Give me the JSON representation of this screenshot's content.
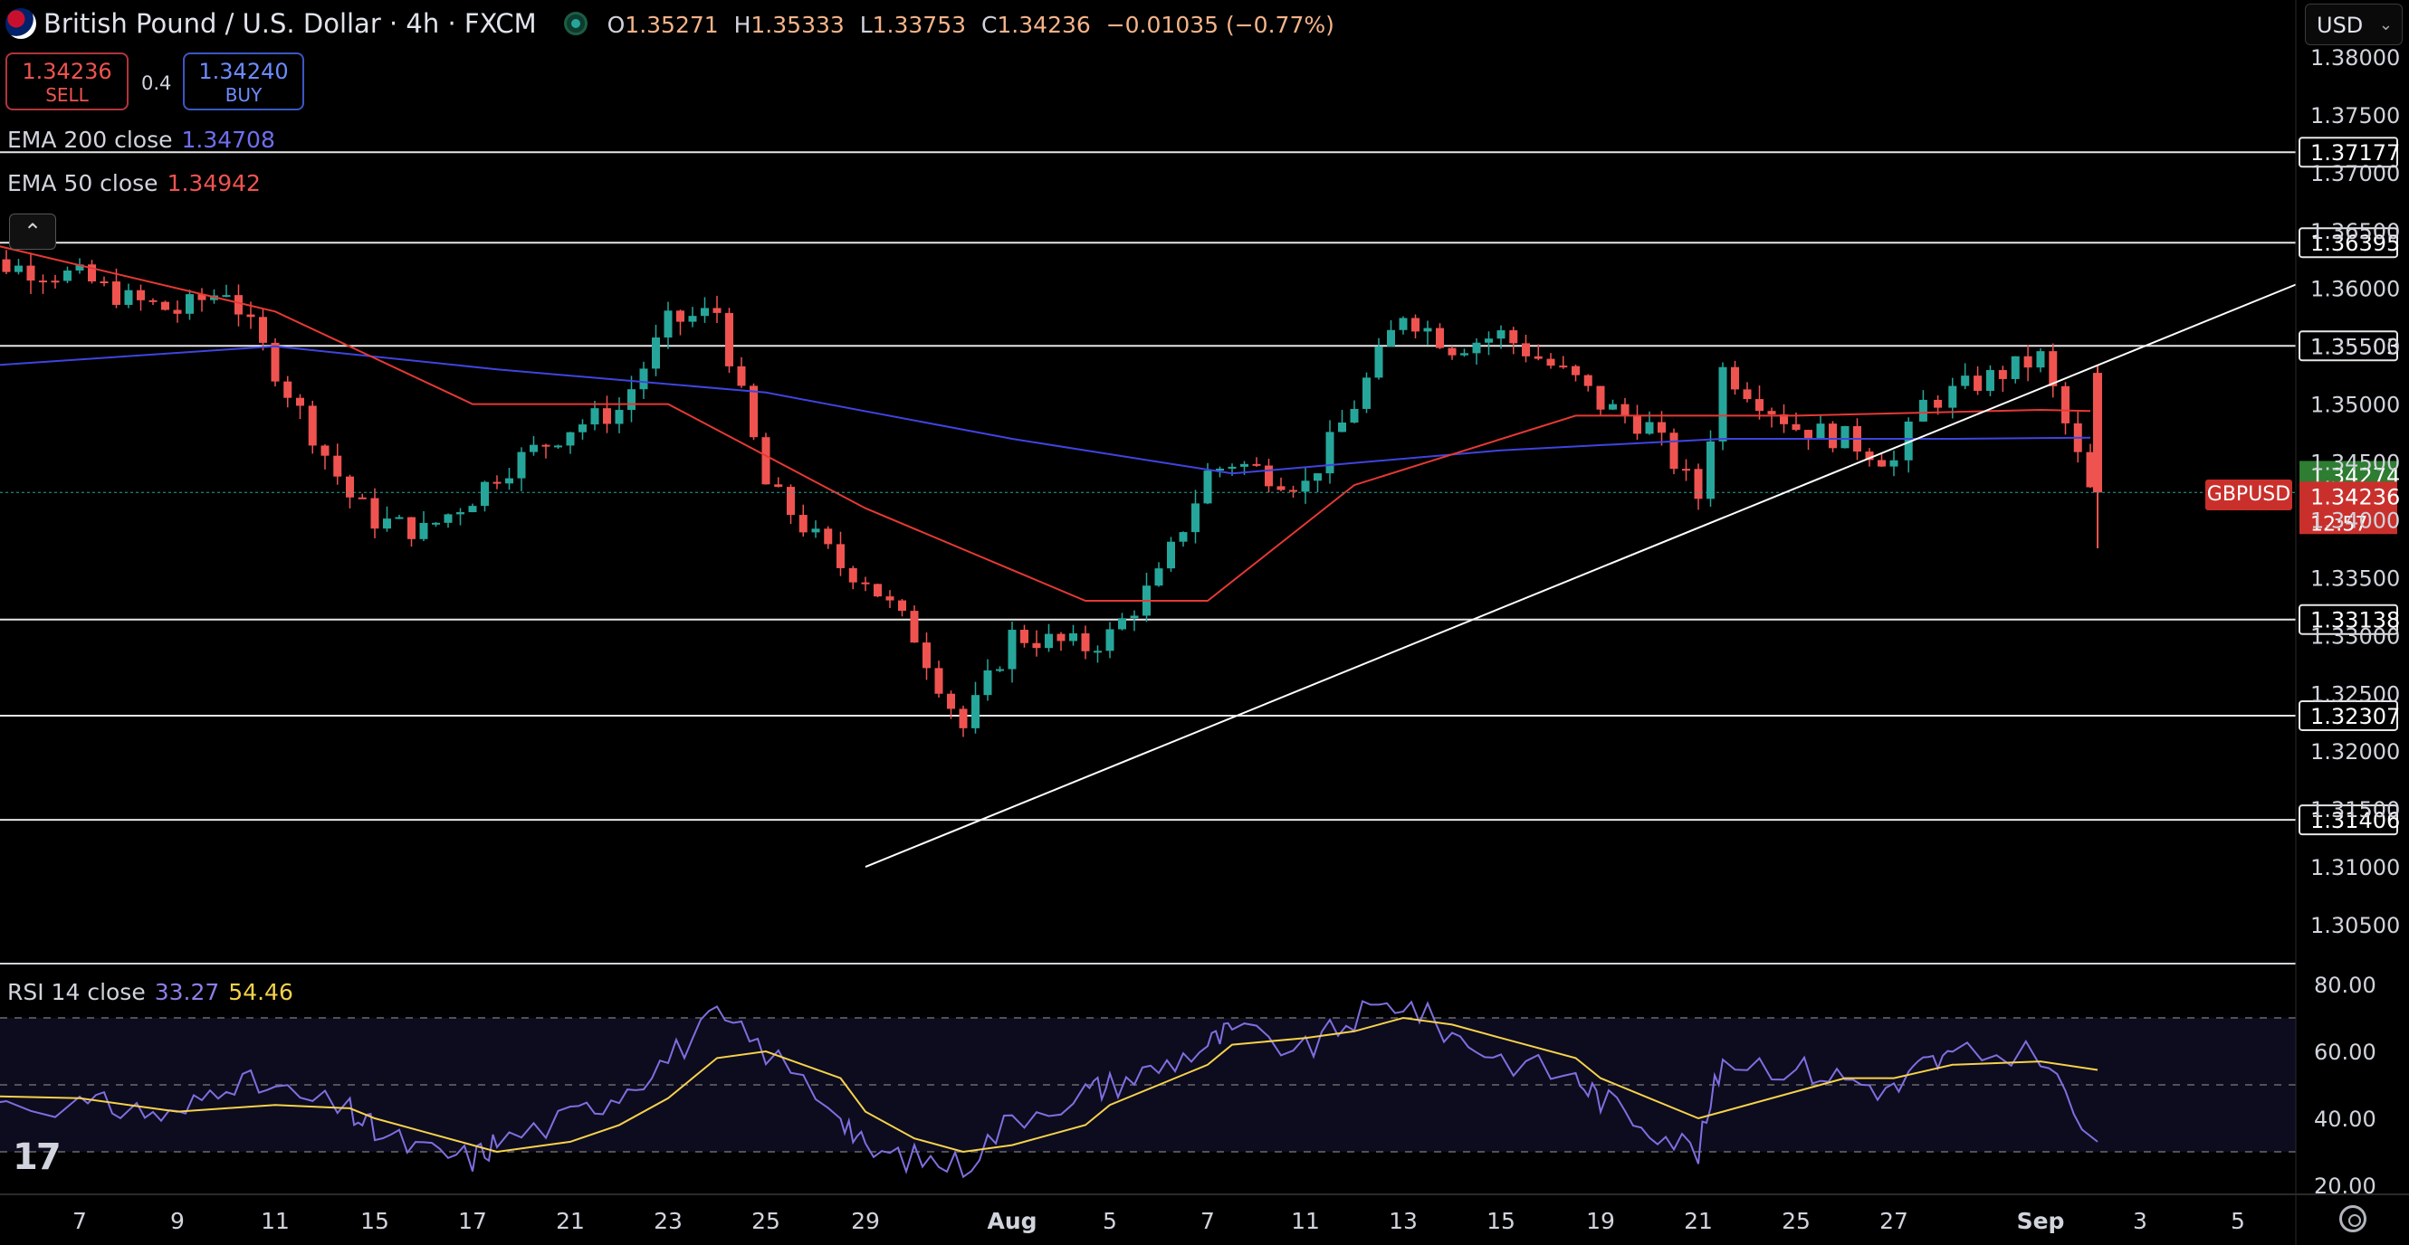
{
  "header": {
    "title": "British Pound / U.S. Dollar · 4h · FXCM",
    "open_label": "O",
    "open": "1.35271",
    "high_label": "H",
    "high": "1.35333",
    "low_label": "L",
    "low": "1.33753",
    "close_label": "C",
    "close": "1.34236",
    "change": "−0.01035 (−0.77%)"
  },
  "trade": {
    "sell_price": "1.34236",
    "sell_label": "SELL",
    "spread": "0.4",
    "buy_price": "1.34240",
    "buy_label": "BUY"
  },
  "indicators": {
    "ema200_label": "EMA 200 close",
    "ema200_value": "1.34708",
    "ema50_label": "EMA 50 close",
    "ema50_value": "1.34942",
    "rsi_label": "RSI 14 close",
    "rsi_value": "33.27",
    "rsi_ma_value": "54.46"
  },
  "toolbar": {
    "currency": "USD"
  },
  "symbol_tag": "GBPUSD",
  "colors": {
    "up": "#26a69a",
    "down": "#ef5350",
    "ema200": "#3f44e0",
    "ema50": "#e53935",
    "rsi": "#7e6fe0",
    "rsi_ma": "#f5d24b",
    "accent_price": "#c9302c",
    "ema_label_green": "#2e7d32"
  },
  "chart_data": [
    {
      "type": "candlestick",
      "price_axis_ticks": [
        "1.38000",
        "1.37500",
        "1.37000",
        "1.36500",
        "1.36000",
        "1.35500",
        "1.35000",
        "1.34500",
        "1.34000",
        "1.33500",
        "1.33000",
        "1.32500",
        "1.32000",
        "1.31500",
        "1.31000",
        "1.30500"
      ],
      "ylim": [
        1.3025,
        1.3825
      ],
      "time_ticks": [
        "7",
        "9",
        "11",
        "15",
        "17",
        "21",
        "23",
        "25",
        "29",
        "Aug",
        "5",
        "7",
        "11",
        "13",
        "15",
        "19",
        "21",
        "25",
        "27",
        "Sep",
        "3",
        "5"
      ],
      "horizontal_levels": [
        "1.37177",
        "1.36395",
        "1.35503",
        "1.33138",
        "1.32307",
        "1.31406"
      ],
      "trendline": {
        "from": {
          "x": "Jul 29",
          "y": 1.31
        },
        "to": {
          "x": "Sep 2",
          "y": 1.3531
        }
      },
      "price_labels": [
        {
          "label": "1.34274",
          "kind": "ema50"
        },
        {
          "label": "1.34236",
          "kind": "last",
          "countdown": "12:57"
        }
      ],
      "close_path": [
        {
          "x": "Jul 4",
          "y": 1.363
        },
        {
          "x": "Jul 7",
          "y": 1.361
        },
        {
          "x": "Jul 8",
          "y": 1.359
        },
        {
          "x": "Jul 9",
          "y": 1.358
        },
        {
          "x": "Jul 10",
          "y": 1.36
        },
        {
          "x": "Jul 11",
          "y": 1.353
        },
        {
          "x": "Jul 14",
          "y": 1.342
        },
        {
          "x": "Jul 15",
          "y": 1.34
        },
        {
          "x": "Jul 16",
          "y": 1.339
        },
        {
          "x": "Jul 17",
          "y": 1.342
        },
        {
          "x": "Jul 18",
          "y": 1.344
        },
        {
          "x": "Jul 21",
          "y": 1.348
        },
        {
          "x": "Jul 22",
          "y": 1.3495
        },
        {
          "x": "Jul 23",
          "y": 1.357
        },
        {
          "x": "Jul 24",
          "y": 1.358
        },
        {
          "x": "Jul 25",
          "y": 1.343
        },
        {
          "x": "Jul 28",
          "y": 1.336
        },
        {
          "x": "Jul 29",
          "y": 1.335
        },
        {
          "x": "Jul 30",
          "y": 1.33
        },
        {
          "x": "Jul 31",
          "y": 1.322
        },
        {
          "x": "Aug 1",
          "y": 1.33
        },
        {
          "x": "Aug 4",
          "y": 1.329
        },
        {
          "x": "Aug 5",
          "y": 1.33
        },
        {
          "x": "Aug 6",
          "y": 1.335
        },
        {
          "x": "Aug 7",
          "y": 1.344
        },
        {
          "x": "Aug 8",
          "y": 1.345
        },
        {
          "x": "Aug 11",
          "y": 1.343
        },
        {
          "x": "Aug 12",
          "y": 1.35
        },
        {
          "x": "Aug 13",
          "y": 1.358
        },
        {
          "x": "Aug 14",
          "y": 1.355
        },
        {
          "x": "Aug 15",
          "y": 1.356
        },
        {
          "x": "Aug 18",
          "y": 1.352
        },
        {
          "x": "Aug 19",
          "y": 1.35
        },
        {
          "x": "Aug 20",
          "y": 1.348
        },
        {
          "x": "Aug 21",
          "y": 1.342
        },
        {
          "x": "Aug 22",
          "y": 1.353
        },
        {
          "x": "Aug 25",
          "y": 1.348
        },
        {
          "x": "Aug 26",
          "y": 1.347
        },
        {
          "x": "Aug 27",
          "y": 1.345
        },
        {
          "x": "Aug 28",
          "y": 1.35
        },
        {
          "x": "Aug 29",
          "y": 1.351
        },
        {
          "x": "Sep 1",
          "y": 1.354
        },
        {
          "x": "Sep 2",
          "y": 1.3424
        }
      ],
      "ema200_path": [
        {
          "x": "Jul 4",
          "y": 1.353
        },
        {
          "x": "Jul 11",
          "y": 1.355
        },
        {
          "x": "Jul 18",
          "y": 1.353
        },
        {
          "x": "Jul 25",
          "y": 1.351
        },
        {
          "x": "Aug 1",
          "y": 1.347
        },
        {
          "x": "Aug 8",
          "y": 1.344
        },
        {
          "x": "Aug 15",
          "y": 1.346
        },
        {
          "x": "Aug 22",
          "y": 1.347
        },
        {
          "x": "Aug 29",
          "y": 1.347
        },
        {
          "x": "Sep 2",
          "y": 1.3471
        }
      ],
      "ema50_path": [
        {
          "x": "Jul 4",
          "y": 1.365
        },
        {
          "x": "Jul 11",
          "y": 1.358
        },
        {
          "x": "Jul 17",
          "y": 1.35
        },
        {
          "x": "Jul 23",
          "y": 1.35
        },
        {
          "x": "Jul 29",
          "y": 1.341
        },
        {
          "x": "Aug 4",
          "y": 1.333
        },
        {
          "x": "Aug 7",
          "y": 1.333
        },
        {
          "x": "Aug 12",
          "y": 1.343
        },
        {
          "x": "Aug 18",
          "y": 1.349
        },
        {
          "x": "Aug 25",
          "y": 1.349
        },
        {
          "x": "Sep 1",
          "y": 1.3495
        },
        {
          "x": "Sep 2",
          "y": 1.3494
        }
      ]
    },
    {
      "type": "line",
      "title": "RSI 14 close",
      "ylim": [
        20,
        80
      ],
      "y_ticks": [
        "80.00",
        "60.00",
        "40.00",
        "20.00"
      ],
      "bands": [
        70,
        50,
        30
      ],
      "series": [
        {
          "name": "RSI",
          "values": [
            48,
            44,
            43,
            40,
            52,
            48,
            42,
            36,
            30,
            28,
            33,
            40,
            48,
            58,
            70,
            60,
            42,
            30,
            28,
            26,
            40,
            48,
            50,
            55,
            62,
            66,
            60,
            70,
            75,
            65,
            58,
            52,
            46,
            38,
            30,
            58,
            55,
            52,
            48,
            56,
            58,
            60,
            33
          ]
        },
        {
          "name": "MA",
          "values": [
            47,
            46,
            44,
            42,
            43,
            44,
            43,
            40,
            36,
            32,
            30,
            33,
            38,
            46,
            58,
            60,
            52,
            42,
            34,
            30,
            32,
            38,
            44,
            50,
            56,
            62,
            64,
            66,
            70,
            68,
            64,
            58,
            52,
            46,
            40,
            42,
            48,
            52,
            52,
            54,
            56,
            57,
            54.46
          ]
        }
      ]
    }
  ]
}
